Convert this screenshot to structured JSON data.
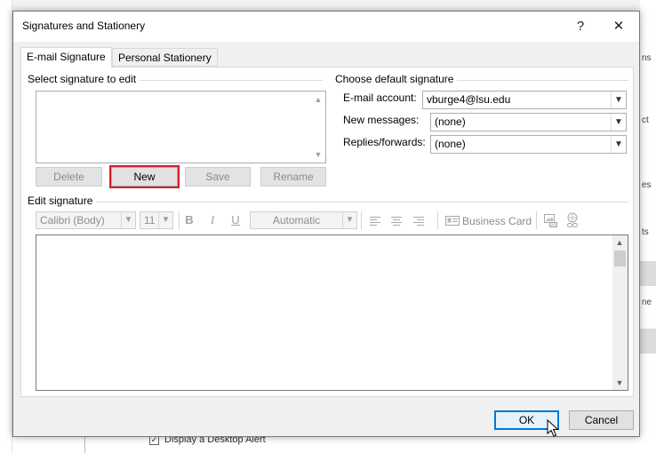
{
  "dialog": {
    "title": "Signatures and Stationery",
    "help_glyph": "?",
    "close_glyph": "✕"
  },
  "tabs": [
    {
      "label": "E-mail Signature",
      "active": true
    },
    {
      "label": "Personal Stationery",
      "active": false
    }
  ],
  "select_signature": {
    "group_label": "Select signature to edit",
    "buttons": {
      "delete": "Delete",
      "new": "New",
      "save": "Save",
      "rename": "Rename"
    }
  },
  "default_signature": {
    "group_label": "Choose default signature",
    "email_account_label": "E-mail account:",
    "email_account_value": "vburge4@lsu.edu",
    "new_messages_label": "New messages:",
    "new_messages_value": "(none)",
    "replies_label": "Replies/forwards:",
    "replies_value": "(none)"
  },
  "edit_signature": {
    "group_label": "Edit signature",
    "font_name": "Calibri (Body)",
    "font_size": "11",
    "bold_glyph": "B",
    "italic_glyph": "I",
    "underline_glyph": "U",
    "color_value": "Automatic",
    "business_card_label": "Business Card"
  },
  "footer": {
    "ok": "OK",
    "cancel": "Cancel"
  },
  "background": {
    "checkbox_label": "Display a Desktop Alert",
    "right_fragments": [
      "ns",
      "ct",
      "es",
      "ts",
      "ne"
    ]
  },
  "colors": {
    "highlight_border": "#d41f2a",
    "default_button_border": "#0078d7"
  }
}
